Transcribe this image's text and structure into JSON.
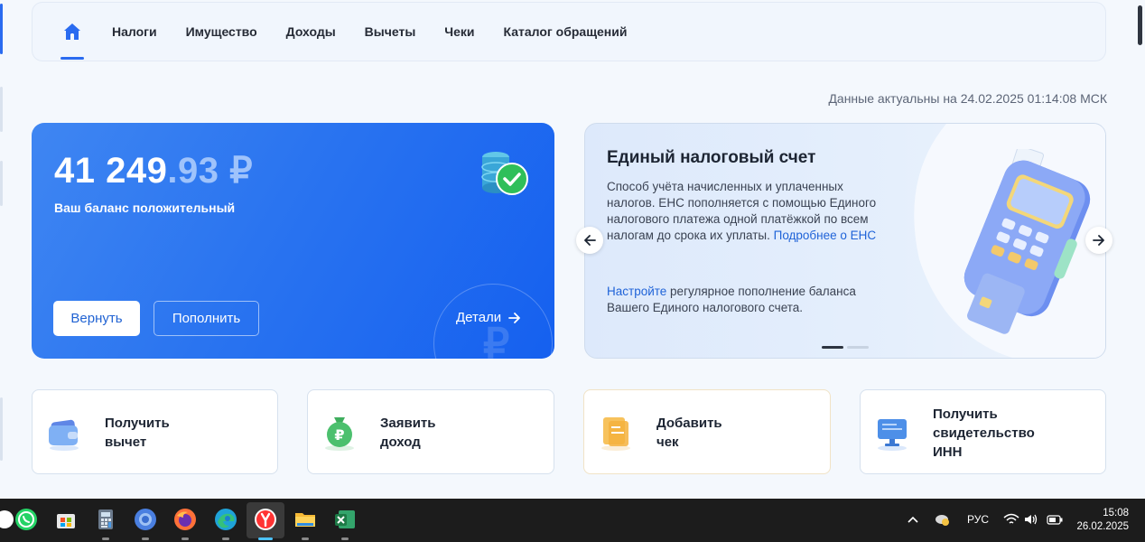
{
  "nav": {
    "home_icon": "home-icon",
    "items": [
      "Налоги",
      "Имущество",
      "Доходы",
      "Вычеты",
      "Чеки",
      "Каталог обращений"
    ]
  },
  "timestamp": "Данные актуальны на 24.02.2025 01:14:08 МСК",
  "balance": {
    "amount_int": "41 249",
    "amount_frac": ".93 ₽",
    "subtitle": "Ваш баланс положительный",
    "return_label": "Вернуть",
    "topup_label": "Пополнить",
    "details_label": "Детали",
    "ruble_mark": "₽"
  },
  "ens": {
    "title": "Единый налоговый счет",
    "desc": "Способ учёта начисленных и уплаченных налогов. ЕНС пополняется с помощью Единого налогового платежа одной платёжкой по всем налогам до срока их уплаты.",
    "desc_link": "Подробнее о ЕНС",
    "setup_link": "Настройте",
    "setup_text": " регулярное пополнение баланса Вашего Единого налогового счета."
  },
  "actions": {
    "deduction": "Получить вычет",
    "income": "Заявить доход",
    "receipt": "Добавить чек",
    "inn": "Получить свидетельство ИНН"
  },
  "taskbar": {
    "lang": "РУС",
    "time": "15:08",
    "date": "26.02.2025"
  },
  "colors": {
    "accent": "#2a6bf0",
    "card_blue": "#1f6cf0",
    "link": "#1f63d8"
  }
}
